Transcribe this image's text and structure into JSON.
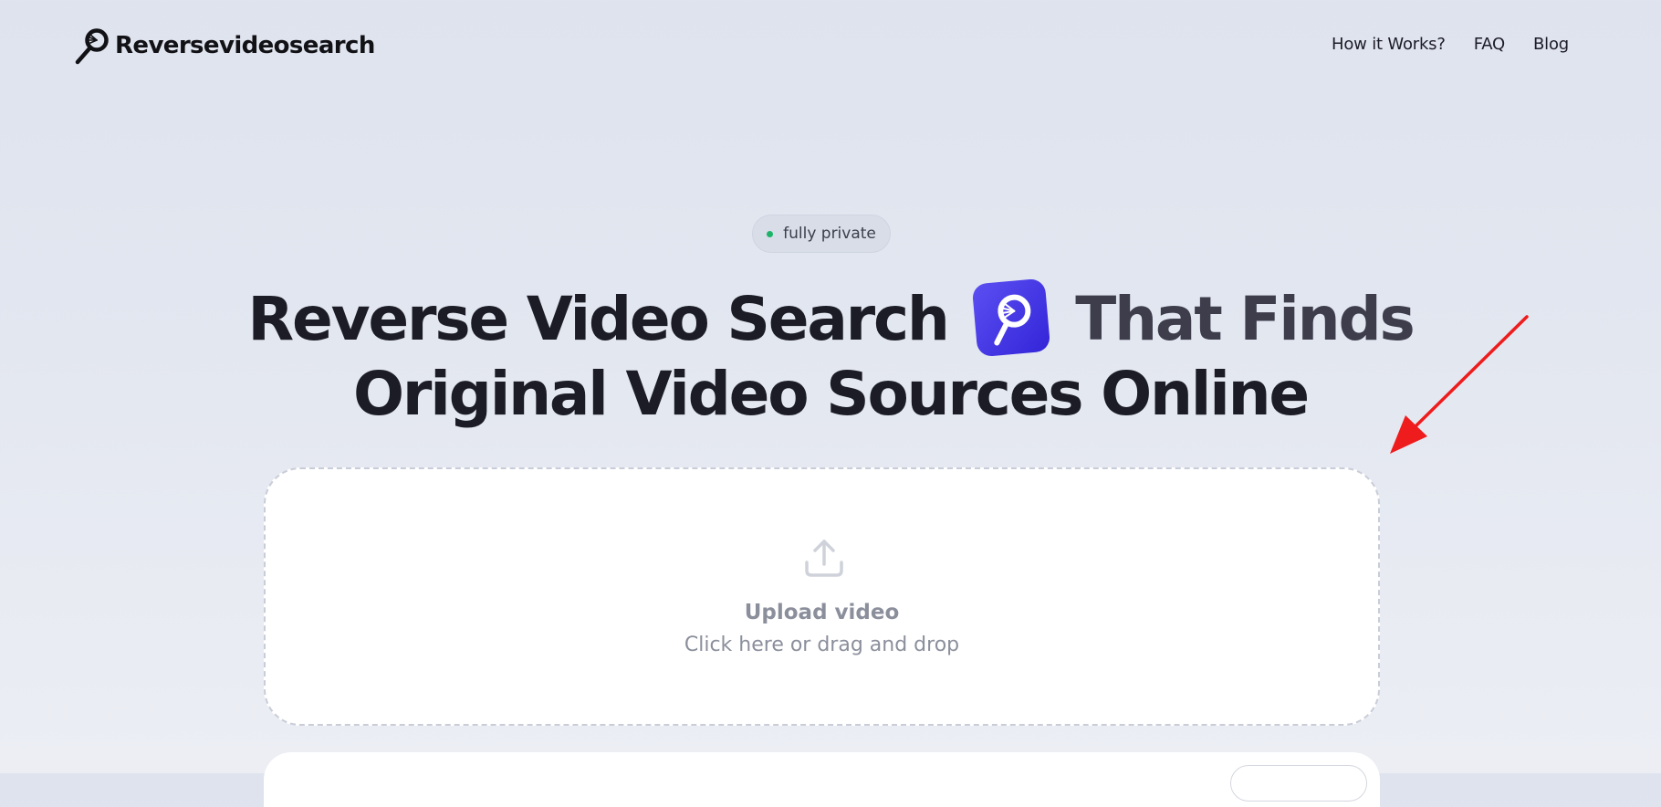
{
  "header": {
    "logo_text": "Reversevideosearch",
    "logo_icon": "magnifier-icon",
    "nav": [
      {
        "label": "How it Works?"
      },
      {
        "label": "FAQ"
      },
      {
        "label": "Blog"
      }
    ]
  },
  "hero": {
    "badge": "fully private",
    "badge_dot_color": "#1fb36a",
    "title_line1_part1": "Reverse Video Search",
    "title_line1_part2": "That Finds",
    "title_line2": "Original Video Sources Online",
    "app_icon": "search-app-icon",
    "app_icon_color": "#4338e8"
  },
  "upload": {
    "icon": "upload-icon",
    "title": "Upload video",
    "subtitle": "Click here or drag and drop"
  },
  "annotation": {
    "type": "arrow",
    "color": "#ee1c1c"
  }
}
